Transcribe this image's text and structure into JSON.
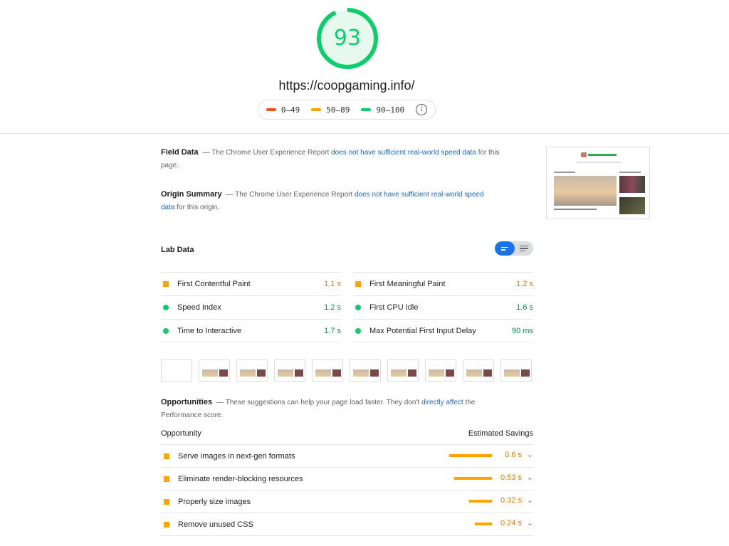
{
  "header": {
    "score": "93",
    "url": "https://coopgaming.info/",
    "legend": [
      {
        "label": "0–49",
        "color": "#f4511e"
      },
      {
        "label": "50–89",
        "color": "#ffa400"
      },
      {
        "label": "90–100",
        "color": "#0cce6b"
      }
    ],
    "info_icon": "i"
  },
  "field_data": {
    "title": "Field Data",
    "text_before": "— The Chrome User Experience Report ",
    "link": "does not have sufficient real-world speed data",
    "text_after": " for this page."
  },
  "origin_summary": {
    "title": "Origin Summary",
    "text_before": "— The Chrome User Experience Report ",
    "link": "does not have sufficient real-world speed data",
    "text_after": " for this origin."
  },
  "lab": {
    "title": "Lab Data",
    "left": [
      {
        "label": "First Contentful Paint",
        "value": "1.1 s",
        "status": "average"
      },
      {
        "label": "Speed Index",
        "value": "1.2 s",
        "status": "pass"
      },
      {
        "label": "Time to Interactive",
        "value": "1.7 s",
        "status": "pass"
      }
    ],
    "right": [
      {
        "label": "First Meaningful Paint",
        "value": "1.2 s",
        "status": "average"
      },
      {
        "label": "First CPU Idle",
        "value": "1.6 s",
        "status": "pass"
      },
      {
        "label": "Max Potential First Input Delay",
        "value": "90 ms",
        "status": "pass"
      }
    ]
  },
  "opportunities": {
    "title": "Opportunities",
    "text_before": "— These suggestions can help your page load faster. They don't ",
    "link": "directly affect",
    "text_after": " the Performance score.",
    "col_opportunity": "Opportunity",
    "col_savings": "Estimated Savings",
    "items": [
      {
        "label": "Serve images in next-gen formats",
        "value": "0.6 s",
        "fraction": 1.0
      },
      {
        "label": "Eliminate render-blocking resources",
        "value": "0.53 s",
        "fraction": 0.88
      },
      {
        "label": "Properly size images",
        "value": "0.32 s",
        "fraction": 0.53
      },
      {
        "label": "Remove unused CSS",
        "value": "0.24 s",
        "fraction": 0.4
      }
    ]
  }
}
